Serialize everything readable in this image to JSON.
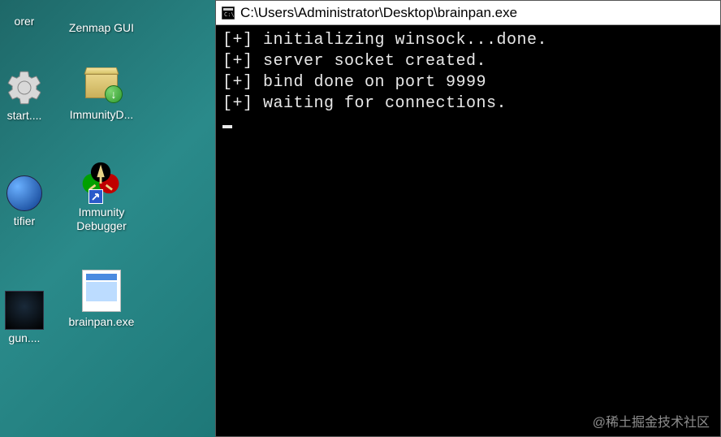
{
  "desktop": {
    "row1": {
      "col1": {
        "label": "orer"
      },
      "col2": {
        "label": "Zenmap GUI"
      }
    },
    "row2": {
      "col1": {
        "label": "start...."
      },
      "col2": {
        "label": "ImmunityD..."
      }
    },
    "row3": {
      "col1": {
        "label": "tifier"
      },
      "col2": {
        "label": "Immunity Debugger"
      }
    },
    "row4": {
      "col1": {
        "label": "gun...."
      },
      "col2": {
        "label": "brainpan.exe"
      }
    }
  },
  "console": {
    "title": "C:\\Users\\Administrator\\Desktop\\brainpan.exe",
    "lines": [
      "[+] initializing winsock...done.",
      "[+] server socket created.",
      "[+] bind done on port 9999",
      "[+] waiting for connections."
    ]
  },
  "watermark": "@稀土掘金技术社区"
}
